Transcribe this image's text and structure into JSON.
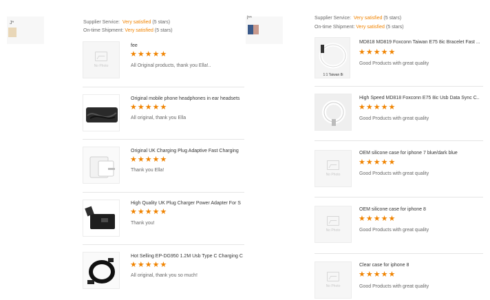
{
  "supplier_label": "Supplier Service:",
  "ontime_label": "On-time Shipment:",
  "rating_text": "Very satisfied",
  "rating_stars": "(5 stars)",
  "left_user": {
    "name": "J*",
    "avatar_icon": "user-avatar-icon"
  },
  "right_user": {
    "name": "l**"
  },
  "stars_glyph": "★★★★★",
  "no_photo_text": "No Photo",
  "colors": {
    "accent": "#f08300",
    "text": "#333333",
    "muted": "#666666"
  },
  "left_reviews": [
    {
      "title": "fee",
      "rating": 5,
      "comment": "All Original products, thank you Ella!..",
      "photo": "no-photo"
    },
    {
      "title": "Original mobile phone headphones in ear headsets",
      "rating": 5,
      "comment": "All original, thank you Ella",
      "photo": "earphones"
    },
    {
      "title": "Original UK Charging Plug Adaptive Fast Charging",
      "rating": 5,
      "comment": "Thank you Ella!",
      "photo": "white-charger"
    },
    {
      "title": "High Quality UK Plug Charger Power Adapter For S",
      "rating": 5,
      "comment": "Thank you!",
      "photo": "black-charger"
    },
    {
      "title": "Hot Selling EP-DG950 1.2M Usb Type C Charging C",
      "rating": 5,
      "comment": "All original, thank you so much!",
      "photo": "black-cable"
    }
  ],
  "right_reviews": [
    {
      "title": "MD818 MD819 Foxconn Taiwan E75 8ic Bracelet Fast ...",
      "rating": 5,
      "comment": "Good Products with great quality",
      "photo": "white-cable-box",
      "photo_caption": "1:1 Taiwan 8i"
    },
    {
      "title": "High Speed MD818 Foxconn E75 8ic Usb Data Sync C...",
      "rating": 5,
      "comment": "Good Products with great quality",
      "photo": "coiled-cable"
    },
    {
      "title": "OEM silicone case for iphone 7 blue/dark blue",
      "rating": 5,
      "comment": "Good Products with great quality",
      "photo": "no-photo"
    },
    {
      "title": "OEM silicone case for iphone 8",
      "rating": 5,
      "comment": "Good Products with great quality",
      "photo": "no-photo"
    },
    {
      "title": "Clear case for iphone 8",
      "rating": 5,
      "comment": "Good Products with great quality",
      "photo": "no-photo"
    }
  ]
}
